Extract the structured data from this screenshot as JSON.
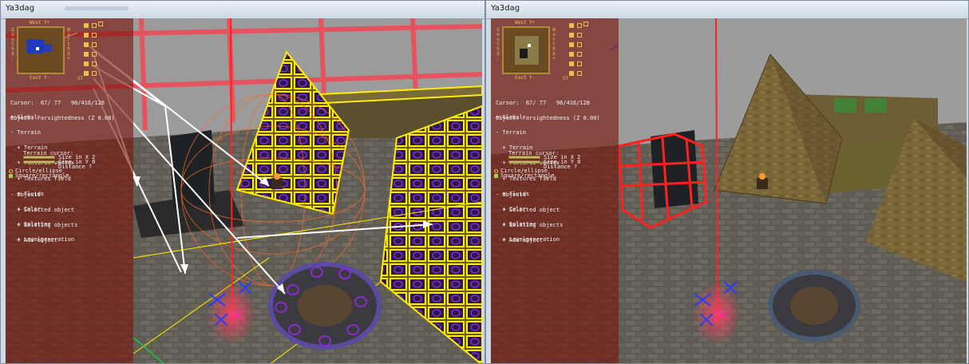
{
  "left_window": {
    "title": "Ya3dag",
    "minimap": {
      "north": "West Y+",
      "south": "East Y-",
      "west": "South X-",
      "east": "North X+",
      "corner_label": "ST"
    },
    "status": {
      "cursor": "Cursor:  67/ 77   96/416/128",
      "object": "Object: Farsightedness (Z 0.00)"
    },
    "tree": [
      "+ Global",
      "- Terrain",
      "  + Terrain",
      "  + Textures vertex",
      "  + Textures field",
      "  + Fluids",
      "  + Color",
      "  + Splatter",
      "  + Levelgeneration"
    ],
    "terrain_cursor": {
      "heading": "Terrain cursor:",
      "size_x": "Size in X 2",
      "size_y": "Size in Y 0",
      "distance": "Distance ?",
      "shape_circle": "Circle/ellipse",
      "shape_square": "Square/rectangle"
    },
    "objects": [
      "- Objects",
      "  + Selected object",
      "  + Existing objects",
      "  + Add object"
    ]
  },
  "right_window": {
    "title": "Ya3dag",
    "minimap": {
      "north": "West Y+",
      "south": "East Y-",
      "west": "South X-",
      "east": "North X+",
      "corner_label": "ST"
    },
    "status": {
      "cursor": "Cursor:  67/ 77   96/416/128",
      "object": "Object: Farsightedness (Z 0.00)"
    },
    "tree": [
      "+ Global",
      "- Terrain",
      "  + Terrain",
      "  + Textures vertex",
      "  + Textures field",
      "  + Fluids",
      "  + Color",
      "  + Splatter",
      "  + Levelgeneration"
    ],
    "terrain_cursor": {
      "heading": "Terrain cursor:",
      "size_x": "Size in X 2",
      "size_y": "Size in Y 0",
      "distance": "Distance ?",
      "shape_circle": "Circle/ellipse",
      "shape_square": "Square/rectangle"
    },
    "objects": [
      "- Objects",
      "  + Selected object",
      "  + Existing objects",
      "  + Add object"
    ]
  },
  "colors": {
    "panel": "#78140a",
    "highlight_wire": "#ffee00",
    "selection_red": "#ff2020",
    "cursor_blue": "#2a3cff",
    "arrow": "#ffffff"
  }
}
